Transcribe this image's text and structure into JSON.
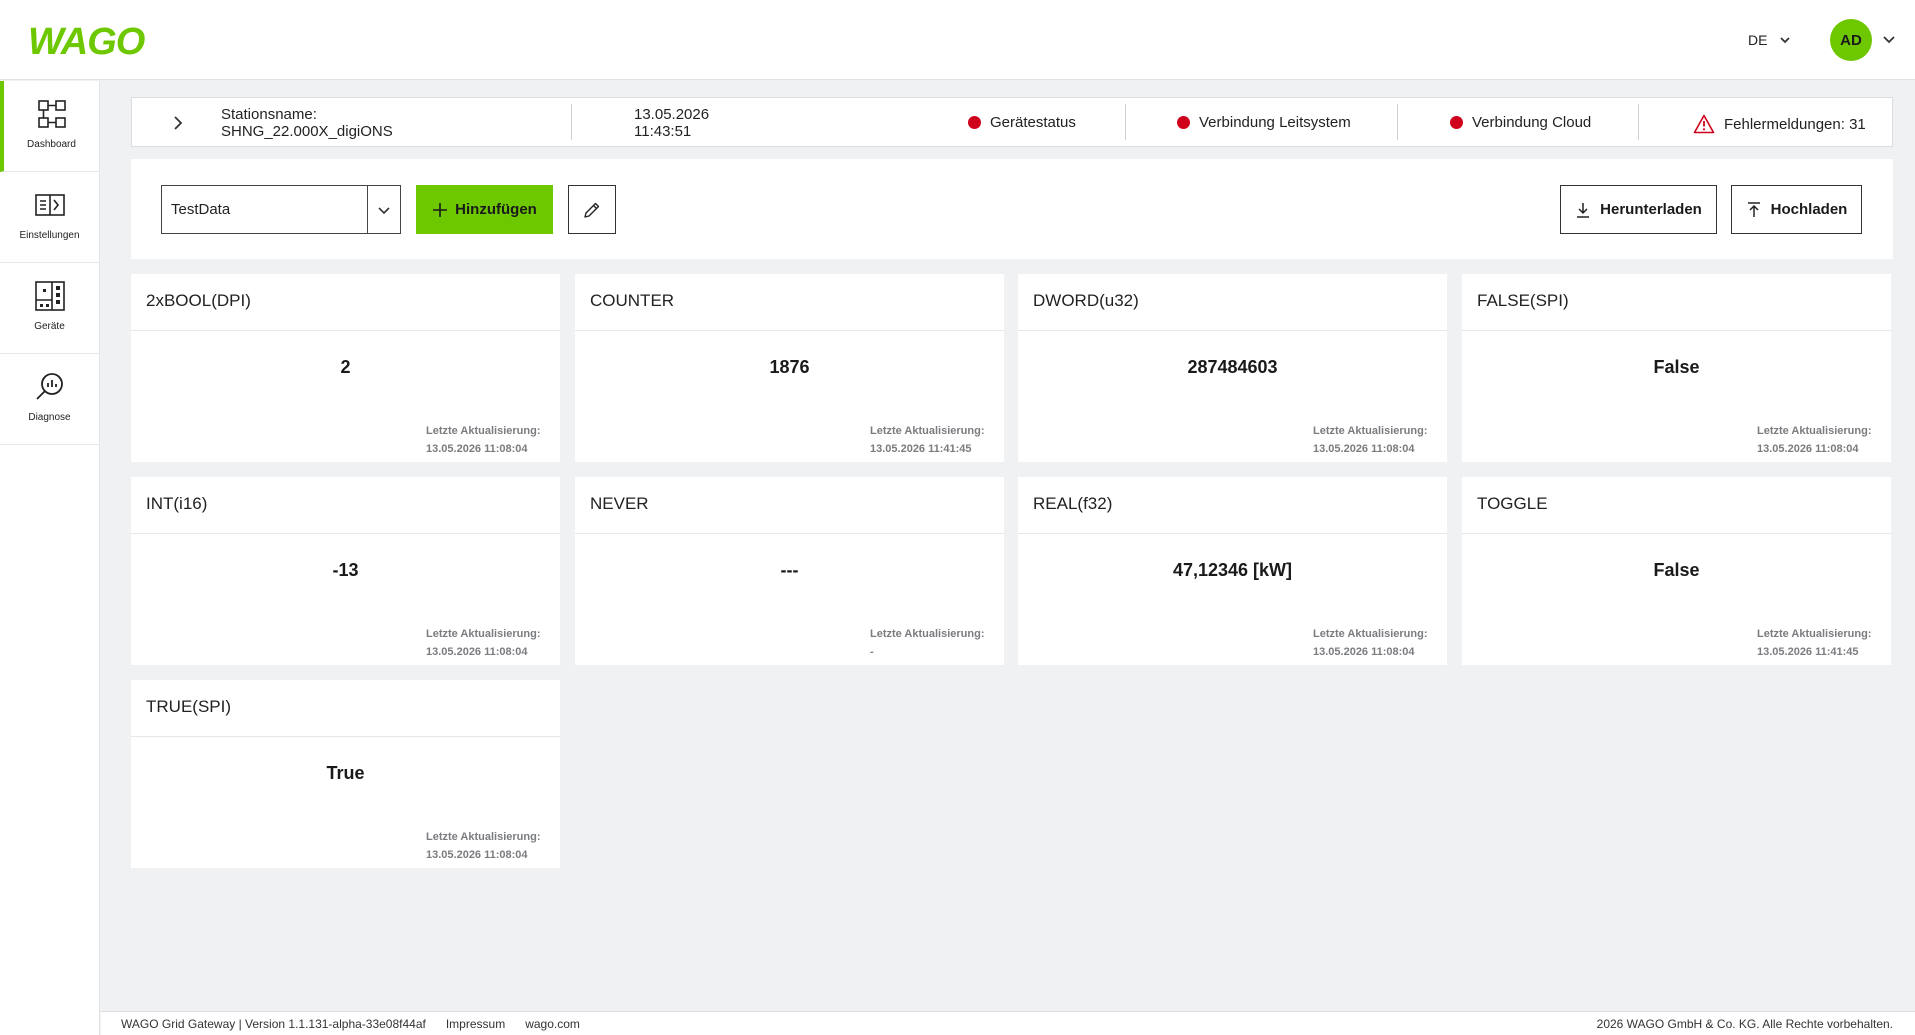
{
  "header": {
    "brand": "WAGO",
    "language": "DE",
    "user_initials": "AD"
  },
  "sidebar": {
    "items": [
      {
        "label": "Dashboard",
        "icon": "dashboard-icon",
        "active": true
      },
      {
        "label": "Einstellungen",
        "icon": "settings-icon",
        "active": false
      },
      {
        "label": "Geräte",
        "icon": "devices-icon",
        "active": false
      },
      {
        "label": "Diagnose",
        "icon": "diagnose-icon",
        "active": false
      }
    ]
  },
  "status": {
    "station_label": "Stationsname:",
    "station_name": "SHNG_22.000X_digiONS",
    "date": "13.05.2026",
    "time": "11:43:51",
    "indicators": [
      {
        "label": "Gerätestatus",
        "color": "#d0021b"
      },
      {
        "label": "Verbindung Leitsystem",
        "color": "#d0021b"
      },
      {
        "label": "Verbindung Cloud",
        "color": "#d0021b"
      }
    ],
    "errors_label": "Fehlermeldungen: 31"
  },
  "toolbar": {
    "selected_dataset": "TestData",
    "add_label": "Hinzufügen",
    "download_label": "Herunterladen",
    "upload_label": "Hochladen"
  },
  "cards_label": "Letzte Aktualisierung:",
  "cards": [
    {
      "title": "2xBOOL(DPI)",
      "value": "2",
      "updated": "13.05.2026 11:08:04"
    },
    {
      "title": "COUNTER",
      "value": "1876",
      "updated": "13.05.2026 11:41:45"
    },
    {
      "title": "DWORD(u32)",
      "value": "287484603",
      "updated": "13.05.2026 11:08:04"
    },
    {
      "title": "FALSE(SPI)",
      "value": "False",
      "updated": "13.05.2026 11:08:04"
    },
    {
      "title": "INT(i16)",
      "value": "-13",
      "updated": "13.05.2026 11:08:04"
    },
    {
      "title": "NEVER",
      "value": "---",
      "updated": "-"
    },
    {
      "title": "REAL(f32)",
      "value": "47,12346 [kW]",
      "updated": "13.05.2026 11:08:04"
    },
    {
      "title": "TOGGLE",
      "value": "False",
      "updated": "13.05.2026 11:41:45"
    },
    {
      "title": "TRUE(SPI)",
      "value": "True",
      "updated": "13.05.2026 11:08:04"
    }
  ],
  "footer": {
    "version": "WAGO Grid Gateway | Version 1.1.131-alpha-33e08f44af",
    "impressum": "Impressum",
    "website": "wago.com",
    "copyright": "2026 WAGO GmbH & Co. KG. Alle Rechte vorbehalten."
  },
  "colors": {
    "accent": "#6ec800",
    "error": "#d0021b",
    "background": "#f0f1f2"
  }
}
